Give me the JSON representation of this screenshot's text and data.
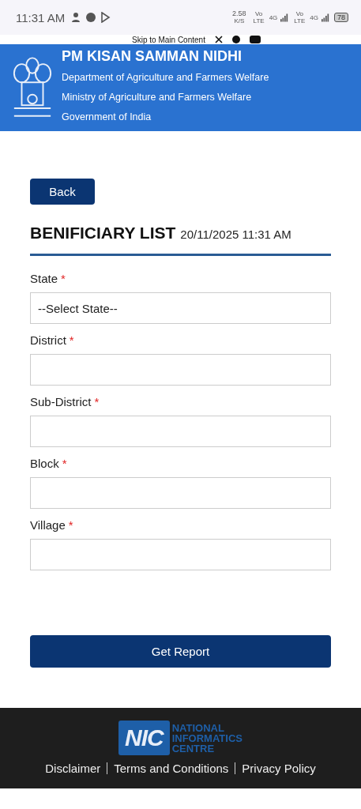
{
  "status_bar": {
    "time": "11:31 AM",
    "speed": "2.58",
    "speed_unit": "K/S",
    "sims": [
      {
        "volte": "Vo LTE",
        "network": "4G"
      },
      {
        "volte": "Vo LTE",
        "network": "4G"
      }
    ],
    "battery": "78"
  },
  "skip_bar": {
    "link": "Skip to Main Content"
  },
  "header": {
    "title": "PM KISAN SAMMAN NIDHI",
    "lines": [
      "Department of Agriculture and Farmers Welfare",
      "Ministry of Agriculture and Farmers Welfare",
      "Government of India"
    ]
  },
  "back_button": "Back",
  "page_title": {
    "title": "BENIFICIARY LIST",
    "timestamp": "20/11/2025 11:31 AM"
  },
  "fields": [
    {
      "label": "State",
      "required_mark": "*",
      "kind": "select",
      "value": "--Select State--"
    },
    {
      "label": "District",
      "required_mark": "*",
      "kind": "select"
    },
    {
      "label": "Sub-District",
      "required_mark": "*",
      "kind": "select"
    },
    {
      "label": "Block",
      "required_mark": "*",
      "kind": "select"
    },
    {
      "label": "Village",
      "required_mark": "*",
      "kind": "select"
    }
  ],
  "submit_button": "Get Report",
  "footer": {
    "logo_mark": "NIC",
    "logo_lines": [
      "NATIONAL",
      "INFORMATICS",
      "CENTRE"
    ],
    "links": [
      "Disclaimer",
      "Terms and Conditions",
      "Privacy Policy"
    ]
  }
}
